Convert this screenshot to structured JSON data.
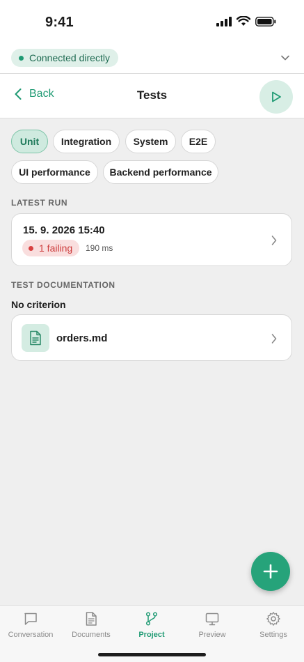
{
  "status_bar": {
    "time": "9:41"
  },
  "connection": {
    "label": "Connected directly",
    "color": "#1f9a73"
  },
  "nav": {
    "back_label": "Back",
    "title": "Tests"
  },
  "filters": [
    {
      "label": "Unit",
      "active": true
    },
    {
      "label": "Integration",
      "active": false
    },
    {
      "label": "System",
      "active": false
    },
    {
      "label": "E2E",
      "active": false
    },
    {
      "label": "UI performance",
      "active": false
    },
    {
      "label": "Backend performance",
      "active": false
    }
  ],
  "latest_run": {
    "section_label": "LATEST RUN",
    "date": "15. 9. 2026 15:40",
    "status": "1 failing",
    "duration": "190 ms",
    "status_color": "#d84040"
  },
  "documentation": {
    "section_label": "TEST DOCUMENTATION",
    "criterion": "No criterion",
    "file_name": "orders.md"
  },
  "tabs": [
    {
      "label": "Conversation",
      "icon": "chat-bubble-icon",
      "active": false
    },
    {
      "label": "Documents",
      "icon": "document-icon",
      "active": false
    },
    {
      "label": "Project",
      "icon": "git-branch-icon",
      "active": true
    },
    {
      "label": "Preview",
      "icon": "monitor-icon",
      "active": false
    },
    {
      "label": "Settings",
      "icon": "gear-icon",
      "active": false
    }
  ],
  "colors": {
    "accent": "#1f9a73",
    "fab": "#26a37a",
    "background": "#efefef"
  }
}
